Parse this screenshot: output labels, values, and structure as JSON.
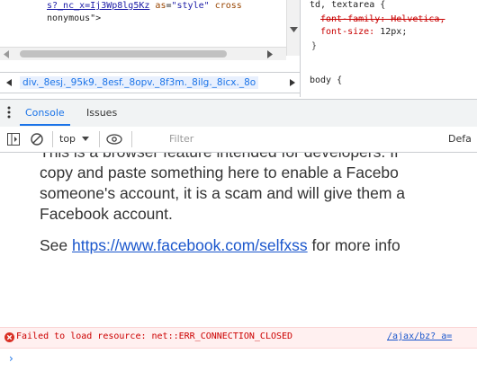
{
  "elements": {
    "line1_prefix": "s?_nc_x=Ij3Wp8lg5Kz",
    "line1_attr": "as",
    "line1_eq": "=",
    "line1_value": "\"style\"",
    "line1_tail": "cross",
    "line2": "nonymous\">"
  },
  "breadcrumb": {
    "path": "div._8esj._95k9._8esf._8opv._8f3m._8ilg._8icx._8o"
  },
  "styles": {
    "selector1": "td, textarea {",
    "strike_prop": "font-family: Helvetica,",
    "prop": "font-size:",
    "prop_value": "12px;",
    "close": "}",
    "selector2": "body {"
  },
  "tabs": [
    {
      "label": "Console"
    },
    {
      "label": "Issues"
    }
  ],
  "toolbar": {
    "context": "top",
    "filter_placeholder": "Filter",
    "default_levels": "Defa"
  },
  "console": {
    "msg_line0": "This is a browser feature intended for developers. If",
    "msg_line1": "copy and paste something here to enable a Facebo",
    "msg_line2": "someone's account, it is a scam and will give them a",
    "msg_line3": "Facebook account.",
    "see": "See",
    "link": "https://www.facebook.com/selfxss",
    "more": "for more info",
    "error_text": "Failed to load resource: net::ERR_CONNECTION_CLOSED",
    "error_link": "/ajax/bz?  a=",
    "prompt": "›"
  },
  "colors": {
    "accent": "#1a73e8",
    "error": "#cc0000",
    "error_bg": "#fff0f0"
  },
  "icons": [
    "kebab-menu-icon",
    "sidebar-toggle-icon",
    "clear-console-icon",
    "eye-icon",
    "error-circle-icon",
    "caret-left-icon",
    "caret-right-icon",
    "dropdown-arrow-icon"
  ]
}
